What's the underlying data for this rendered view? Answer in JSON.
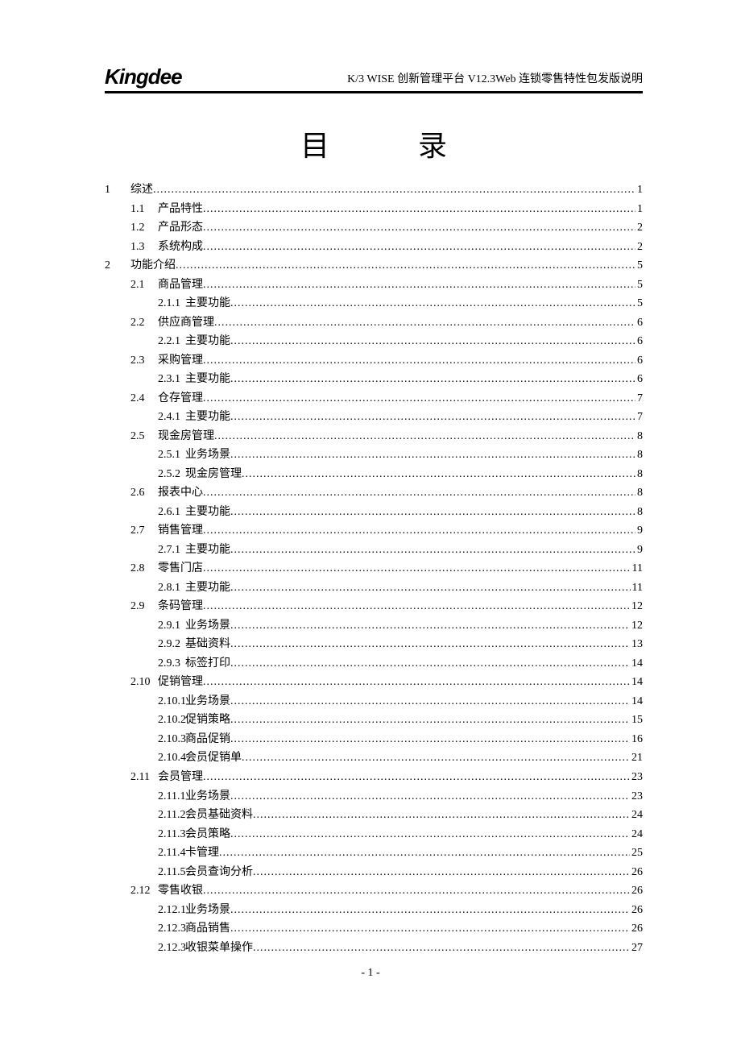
{
  "header": {
    "logo": "Kingdee",
    "right": "K/3 WISE 创新管理平台  V12.3Web 连锁零售特性包发版说明"
  },
  "title": {
    "char1": "目",
    "char2": "录"
  },
  "footer": "- 1 -",
  "toc": [
    {
      "type": "top",
      "num": "1",
      "label": "综述",
      "page": "1"
    },
    {
      "type": "l1",
      "num": "1.1",
      "label": "产品特性",
      "page": "1"
    },
    {
      "type": "l1",
      "num": "1.2",
      "label": "产品形态",
      "page": "2"
    },
    {
      "type": "l1",
      "num": "1.3",
      "label": "系统构成",
      "page": "2"
    },
    {
      "type": "top",
      "num": "2",
      "label": "功能介绍",
      "page": "5"
    },
    {
      "type": "l1",
      "num": "2.1",
      "label": "商品管理",
      "page": "5"
    },
    {
      "type": "l2",
      "num": "2.1.1",
      "label": "主要功能",
      "page": "5"
    },
    {
      "type": "l1",
      "num": "2.2",
      "label": "供应商管理",
      "page": "6"
    },
    {
      "type": "l2",
      "num": "2.2.1",
      "label": "主要功能",
      "page": "6"
    },
    {
      "type": "l1",
      "num": "2.3",
      "label": "采购管理",
      "page": "6"
    },
    {
      "type": "l2",
      "num": "2.3.1",
      "label": "主要功能",
      "page": "6"
    },
    {
      "type": "l1",
      "num": "2.4",
      "label": "仓存管理",
      "page": "7"
    },
    {
      "type": "l2",
      "num": "2.4.1",
      "label": "主要功能",
      "page": "7"
    },
    {
      "type": "l1",
      "num": "2.5",
      "label": "现金房管理",
      "page": "8"
    },
    {
      "type": "l2",
      "num": "2.5.1",
      "label": "业务场景",
      "page": "8"
    },
    {
      "type": "l2",
      "num": "2.5.2",
      "label": "现金房管理",
      "page": "8"
    },
    {
      "type": "l1",
      "num": "2.6",
      "label": "报表中心",
      "page": "8"
    },
    {
      "type": "l2",
      "num": "2.6.1",
      "label": "主要功能",
      "page": "8"
    },
    {
      "type": "l1",
      "num": "2.7",
      "label": "销售管理",
      "page": "9"
    },
    {
      "type": "l2",
      "num": "2.7.1",
      "label": "主要功能",
      "page": "9"
    },
    {
      "type": "l1",
      "num": "2.8",
      "label": "零售门店",
      "page": "11"
    },
    {
      "type": "l2",
      "num": "2.8.1",
      "label": "主要功能",
      "page": "11"
    },
    {
      "type": "l1",
      "num": "2.9",
      "label": "条码管理",
      "page": "12"
    },
    {
      "type": "l2",
      "num": "2.9.1",
      "label": "业务场景",
      "page": "12"
    },
    {
      "type": "l2",
      "num": "2.9.2",
      "label": "基础资料",
      "page": "13"
    },
    {
      "type": "l2",
      "num": "2.9.3",
      "label": "标签打印",
      "page": "14"
    },
    {
      "type": "l1",
      "num": "2.10",
      "label": "促销管理",
      "page": "14"
    },
    {
      "type": "l2",
      "num": "2.10.1",
      "label": "业务场景",
      "page": "14"
    },
    {
      "type": "l2",
      "num": "2.10.2",
      "label": "促销策略",
      "page": "15"
    },
    {
      "type": "l2",
      "num": "2.10.3",
      "label": "商品促销",
      "page": "16"
    },
    {
      "type": "l2",
      "num": "2.10.4",
      "label": "会员促销单",
      "page": "21"
    },
    {
      "type": "l1",
      "num": "2.11",
      "label": "会员管理",
      "page": "23"
    },
    {
      "type": "l2",
      "num": "2.11.1",
      "label": "业务场景",
      "page": "23"
    },
    {
      "type": "l2",
      "num": "2.11.2",
      "label": "会员基础资料",
      "page": "24"
    },
    {
      "type": "l2",
      "num": "2.11.3",
      "label": "会员策略",
      "page": "24"
    },
    {
      "type": "l2",
      "num": "2.11.4",
      "label": "卡管理",
      "page": "25"
    },
    {
      "type": "l2",
      "num": "2.11.5",
      "label": "会员查询分析",
      "page": "26"
    },
    {
      "type": "l1",
      "num": "2.12",
      "label": "零售收银",
      "page": "26"
    },
    {
      "type": "l2",
      "num": "2.12.1",
      "label": "业务场景",
      "page": "26"
    },
    {
      "type": "l2",
      "num": "2.12.3",
      "label": "商品销售",
      "page": "26"
    },
    {
      "type": "l2",
      "num": "2.12.3",
      "label": "收银菜单操作",
      "page": "27"
    }
  ]
}
